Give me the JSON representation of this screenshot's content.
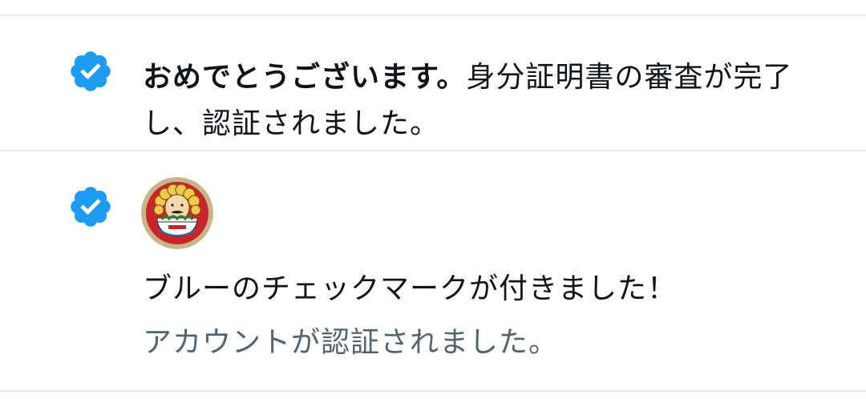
{
  "colors": {
    "verified_badge": "#1d9bf0",
    "primary_text": "#0f1419",
    "secondary_text": "#536471",
    "divider": "#e6e9eb"
  },
  "notifications": [
    {
      "icon": "verified-badge-icon",
      "bold_text": "おめでとうございます。",
      "body_text": "身分証明書の審査が完了し、認証されました。"
    },
    {
      "icon": "verified-badge-icon",
      "avatar": "user-avatar",
      "title": "ブルーのチェックマークが付きました！",
      "subtitle": "アカウントが認証されました。"
    }
  ]
}
